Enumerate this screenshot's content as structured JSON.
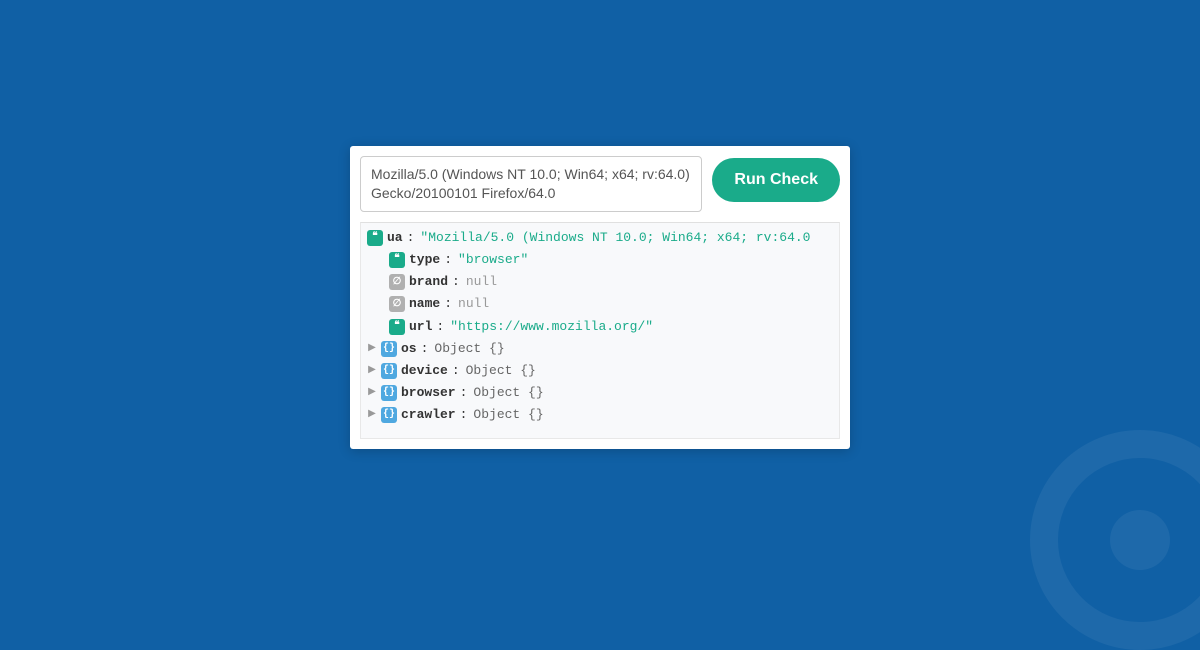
{
  "input": {
    "ua_value": "Mozilla/5.0 (Windows NT 10.0; Win64; x64; rv:64.0) Gecko/20100101 Firefox/64.0",
    "run_label": "Run Check"
  },
  "result": {
    "ua": {
      "key": "ua",
      "value": "\"Mozilla/5.0 (Windows NT 10.0; Win64; x64; rv:64.0"
    },
    "type": {
      "key": "type",
      "value": "\"browser\""
    },
    "brand": {
      "key": "brand",
      "value": "null"
    },
    "name": {
      "key": "name",
      "value": "null"
    },
    "url": {
      "key": "url",
      "value": "\"https://www.mozilla.org/\""
    },
    "os": {
      "key": "os",
      "value": "Object {}"
    },
    "device": {
      "key": "device",
      "value": "Object {}"
    },
    "browser": {
      "key": "browser",
      "value": "Object {}"
    },
    "crawler": {
      "key": "crawler",
      "value": "Object {}"
    }
  },
  "glyphs": {
    "triangle": "▶"
  }
}
